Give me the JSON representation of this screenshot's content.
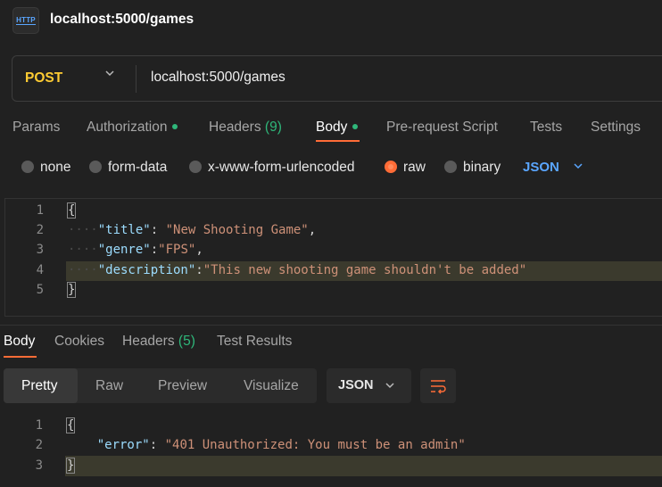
{
  "header": {
    "http_icon_text": "HTTP",
    "title": "localhost:5000/games"
  },
  "request": {
    "method": "POST",
    "url": "localhost:5000/games",
    "tabs": [
      {
        "label": "Params"
      },
      {
        "label": "Authorization"
      },
      {
        "label": "Headers",
        "count": "(9)"
      },
      {
        "label": "Body"
      },
      {
        "label": "Pre-request Script"
      },
      {
        "label": "Tests"
      },
      {
        "label": "Settings"
      }
    ],
    "active_tab": "Body",
    "body_types": [
      "none",
      "form-data",
      "x-www-form-urlencoded",
      "raw",
      "binary"
    ],
    "selected_body_type": "raw",
    "language": "JSON",
    "code": {
      "line_numbers": [
        "1",
        "2",
        "3",
        "4",
        "5"
      ],
      "open_brace": "{",
      "close_brace": "}",
      "title_key": "\"title\"",
      "title_value": "\"New Shooting Game\"",
      "genre_key": "\"genre\"",
      "genre_value": "\"FPS\"",
      "description_key": "\"description\"",
      "description_value": "\"This new shooting game shouldn't be added\""
    }
  },
  "response": {
    "tabs": [
      {
        "label": "Body"
      },
      {
        "label": "Cookies"
      },
      {
        "label": "Headers",
        "count": "(5)"
      },
      {
        "label": "Test Results"
      }
    ],
    "active_tab": "Body",
    "views": [
      "Pretty",
      "Raw",
      "Preview",
      "Visualize"
    ],
    "active_view": "Pretty",
    "language": "JSON",
    "code": {
      "line_numbers": [
        "1",
        "2",
        "3"
      ],
      "open_brace": "{",
      "close_brace": "}",
      "error_key": "\"error\"",
      "error_value": "\"401 Unauthorized: You must be an admin\""
    }
  },
  "colors": {
    "accent": "#ff6c37",
    "method_post": "#ffcc33",
    "status_dot": "#2fb77a",
    "link_blue": "#5aa6ff"
  },
  "icons": [
    "http-icon",
    "chevron-down-icon",
    "wrap-lines-icon"
  ]
}
